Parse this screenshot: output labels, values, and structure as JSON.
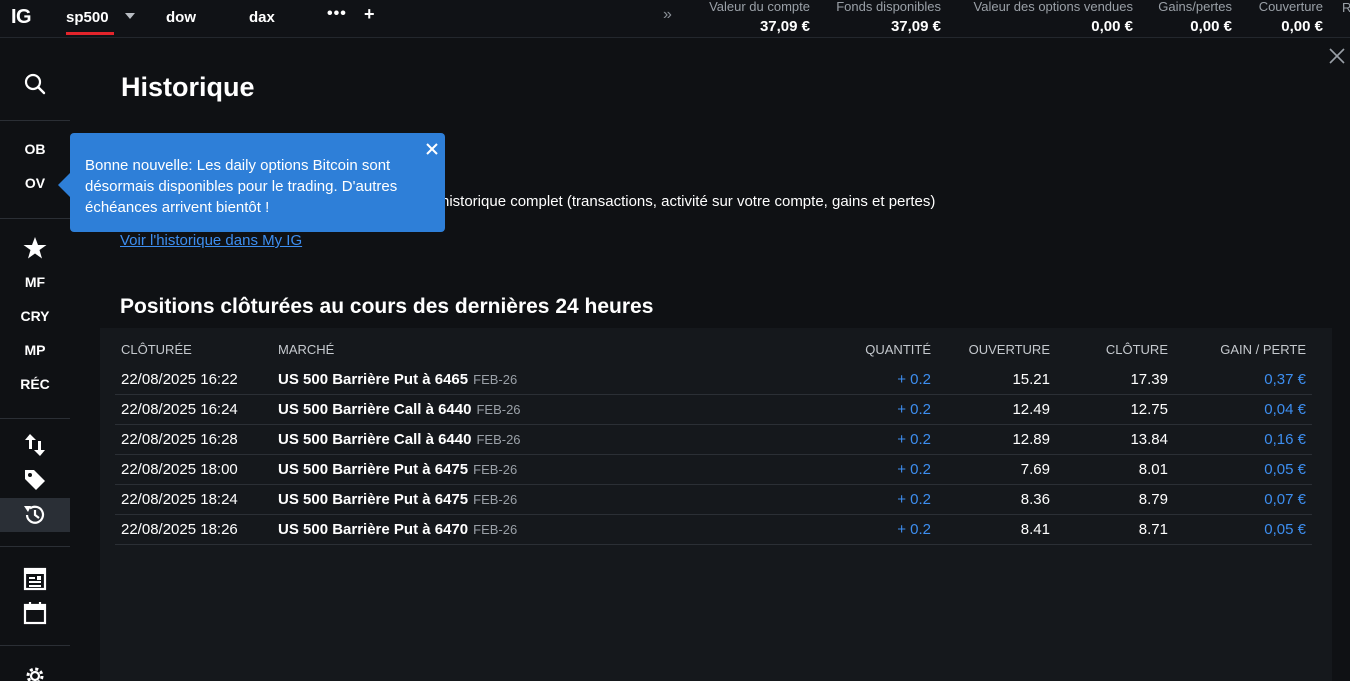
{
  "topbar": {
    "logo": "IG",
    "tabs": [
      {
        "label": "sp500",
        "active": true
      },
      {
        "label": "dow",
        "active": false
      },
      {
        "label": "dax",
        "active": false
      }
    ],
    "more_label": "•••",
    "add_label": "+",
    "expand_label": "»",
    "metrics": [
      {
        "label": "Valeur du compte",
        "value": "37,09 €"
      },
      {
        "label": "Fonds disponibles",
        "value": "37,09 €"
      },
      {
        "label": "Valeur des options vendues",
        "value": "0,00 €"
      },
      {
        "label": "Gains/pertes",
        "value": "0,00 €"
      },
      {
        "label": "Couverture",
        "value": "0,00 €"
      }
    ],
    "metric_cut": "R"
  },
  "sidebar": {
    "items": [
      {
        "label": "OB"
      },
      {
        "label": "OV"
      },
      {
        "label": "MF"
      },
      {
        "label": "CRY"
      },
      {
        "label": "MP"
      },
      {
        "label": "RÉC"
      }
    ],
    "icons": [
      "search-icon",
      "star-icon",
      "transfer-icon",
      "tag-icon",
      "history-icon",
      "news-icon",
      "calendar-icon",
      "settings-icon"
    ],
    "active": "history-icon"
  },
  "tooltip": {
    "text": "Bonne nouvelle: Les daily options Bitcoin sont désormais disponibles pour le trading. D'autres échéances arrivent bientôt !"
  },
  "main": {
    "title": "Historique",
    "intro_text": "historique complet (transactions, activité sur votre compte, gains et pertes)",
    "link_text": "Voir l'historique dans My IG",
    "section_title": "Positions clôturées au cours des dernières 24 heures",
    "columns": [
      "CLÔTURÉE",
      "MARCHÉ",
      "QUANTITÉ",
      "OUVERTURE",
      "CLÔTURE",
      "GAIN / PERTE"
    ],
    "rows": [
      {
        "date": "22/08/2025 16:22",
        "market": "US 500 Barrière Put à 6465",
        "expiry": "FEB-26",
        "qty": "+ 0.2",
        "open": "15.21",
        "close": "17.39",
        "pl": "0,37 €"
      },
      {
        "date": "22/08/2025 16:24",
        "market": "US 500 Barrière Call à 6440",
        "expiry": "FEB-26",
        "qty": "+ 0.2",
        "open": "12.49",
        "close": "12.75",
        "pl": "0,04 €"
      },
      {
        "date": "22/08/2025 16:28",
        "market": "US 500 Barrière Call à 6440",
        "expiry": "FEB-26",
        "qty": "+ 0.2",
        "open": "12.89",
        "close": "13.84",
        "pl": "0,16 €"
      },
      {
        "date": "22/08/2025 18:00",
        "market": "US 500 Barrière Put à 6475",
        "expiry": "FEB-26",
        "qty": "+ 0.2",
        "open": "7.69",
        "close": "8.01",
        "pl": "0,05 €"
      },
      {
        "date": "22/08/2025 18:24",
        "market": "US 500 Barrière Put à 6475",
        "expiry": "FEB-26",
        "qty": "+ 0.2",
        "open": "8.36",
        "close": "8.79",
        "pl": "0,07 €"
      },
      {
        "date": "22/08/2025 18:26",
        "market": "US 500 Barrière Put à 6470",
        "expiry": "FEB-26",
        "qty": "+ 0.2",
        "open": "8.41",
        "close": "8.71",
        "pl": "0,05 €"
      }
    ]
  },
  "colors": {
    "accent_blue": "#3d8ef0",
    "tooltip_blue": "#2e7fd8",
    "brand_red": "#e3242b",
    "background": "#0f1114"
  }
}
